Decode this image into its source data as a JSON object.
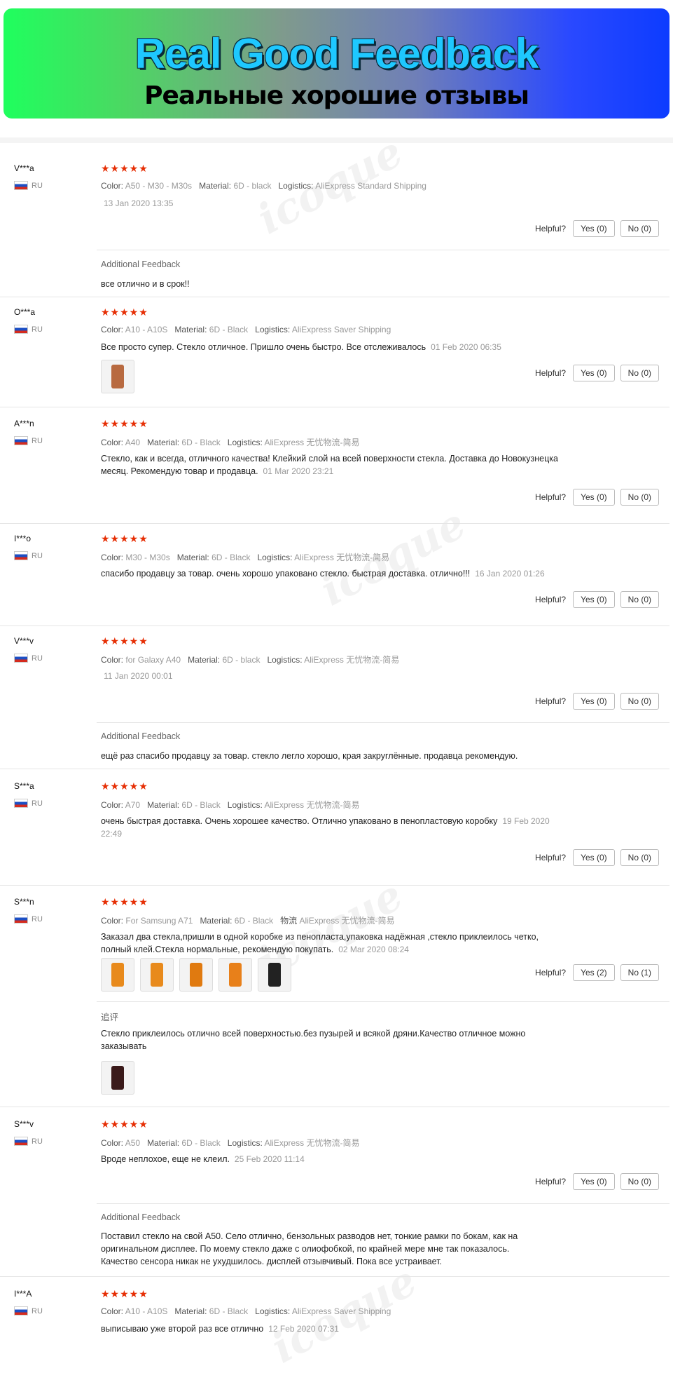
{
  "banner": {
    "title": "Real Good Feedback",
    "subtitle": "Реальные хорошие отзывы"
  },
  "watermark": "icoque",
  "labels": {
    "helpful": "Helpful?",
    "color": "Color:",
    "material": "Material:",
    "logistics": "Logistics:",
    "additional_feedback": "Additional Feedback",
    "additional_feedback_cn": "追评",
    "logistics_cn": "物流"
  },
  "reviews": [
    {
      "user": "V***a",
      "country": "RU",
      "stars": "★★★★★",
      "color": "A50 - M30 - M30s",
      "material": "6D - black",
      "logistics": "AliExpress Standard Shipping",
      "date": "13 Jan 2020  13:35",
      "yes": "Yes (0)",
      "no": "No (0)",
      "additional": "все отлично и в срок!!"
    },
    {
      "user": "O***a",
      "country": "RU",
      "stars": "★★★★★",
      "color": "A10 - A10S",
      "material": "6D - Black",
      "logistics": "AliExpress Saver Shipping",
      "text": "Все просто супер. Стекло отличное. Пришло очень быстро. Все отслеживалось",
      "date": "01 Feb 2020 06:35",
      "yes": "Yes (0)",
      "no": "No (0)"
    },
    {
      "user": "A***n",
      "country": "RU",
      "stars": "★★★★★",
      "color": "A40",
      "material": "6D - Black",
      "logistics": "AliExpress 无忧物流-简易",
      "text1": "Стекло, как и всегда, отличного качества! Клейкий слой на всей поверхности стекла. Доставка до Новокузнецка",
      "text2": "месяц. Рекомендую товар и продавца.",
      "date": "01 Mar 2020 23:21",
      "yes": "Yes (0)",
      "no": "No (0)"
    },
    {
      "user": "I***o",
      "country": "RU",
      "stars": "★★★★★",
      "color": "M30 - M30s",
      "material": "6D - Black",
      "logistics": "AliExpress 无忧物流-简易",
      "text": "спасибо продавцу за товар. очень хорошо упаковано стекло. быстрая доставка. отлично!!!",
      "date": "16  Jan 2020  01:26",
      "yes": "Yes (0)",
      "no": "No (0)"
    },
    {
      "user": "V***v",
      "country": "RU",
      "stars": "★★★★★",
      "color": "for Galaxy A40",
      "material": "6D - black",
      "logistics": "AliExpress 无忧物流-简易",
      "date": "11 Jan 2020 00:01",
      "yes": "Yes (0)",
      "no": "No (0)",
      "additional": "ещё раз спасибо продавцу за товар. стекло легло хорошо, края закруглённые. продавца рекомендую."
    },
    {
      "user": "S***a",
      "country": "RU",
      "stars": "★★★★★",
      "color": "A70",
      "material": "6D - Black",
      "logistics": "AliExpress 无忧物流-简易",
      "text": "очень быстрая доставка. Очень хорошее качество. Отлично упаковано в пенопластовую коробку",
      "date1": "19 Feb 2020",
      "date2": "22:49",
      "yes": "Yes (0)",
      "no": "No (0)"
    },
    {
      "user": "S***n",
      "country": "RU",
      "stars": "★★★★★",
      "color": "For Samsung A71",
      "material": "6D - Black",
      "logistics": "AliExpress 无忧物流-简易",
      "text1": "Заказал два стекла,пришли в одной коробке из пенопласта,упаковка надёжная ,стекло приклеилось четко,",
      "text2": "полный клей.Стекла нормальные, рекомендую покупать.",
      "date": "02 Mar 2020 08:24",
      "yes": "Yes (2)",
      "no": "No (1)",
      "additional1": "Стекло приклеилось отлично всей поверхностью.без пузырей и всякой дряни.Качество отличное можно",
      "additional2": "заказывать"
    },
    {
      "user": "S***v",
      "country": "RU",
      "stars": "★★★★★",
      "color": "A50",
      "material": "6D - Black",
      "logistics": "AliExpress 无忧物流-简易",
      "text": "Вроде неплохое, еще не клеил.",
      "date": "25 Feb 2020 11:14",
      "yes": "Yes (0)",
      "no": "No (0)",
      "additional1": "Поставил стекло на свой A50. Село отлично, бензольных разводов нет, тонкие рамки по бокам, как на",
      "additional2": "оригинальном дисплее. По моему стекло даже с олиофобкой, по крайней мере мне так показалось.",
      "additional3": "Качество сенсора никак не ухудшилось. дисплей отзывчивый. Пока все устраивает."
    },
    {
      "user": "I***A",
      "country": "RU",
      "stars": "★★★★★",
      "color": "A10 - A10S",
      "material": "6D - Black",
      "logistics": "AliExpress Saver Shipping",
      "text": "выписываю уже второй раз все отлично",
      "date": "12 Feb 2020 07:31"
    }
  ],
  "colors": {
    "star": "#e62e04",
    "banner_left": "#1fff5e",
    "banner_right": "#0d3cff"
  }
}
